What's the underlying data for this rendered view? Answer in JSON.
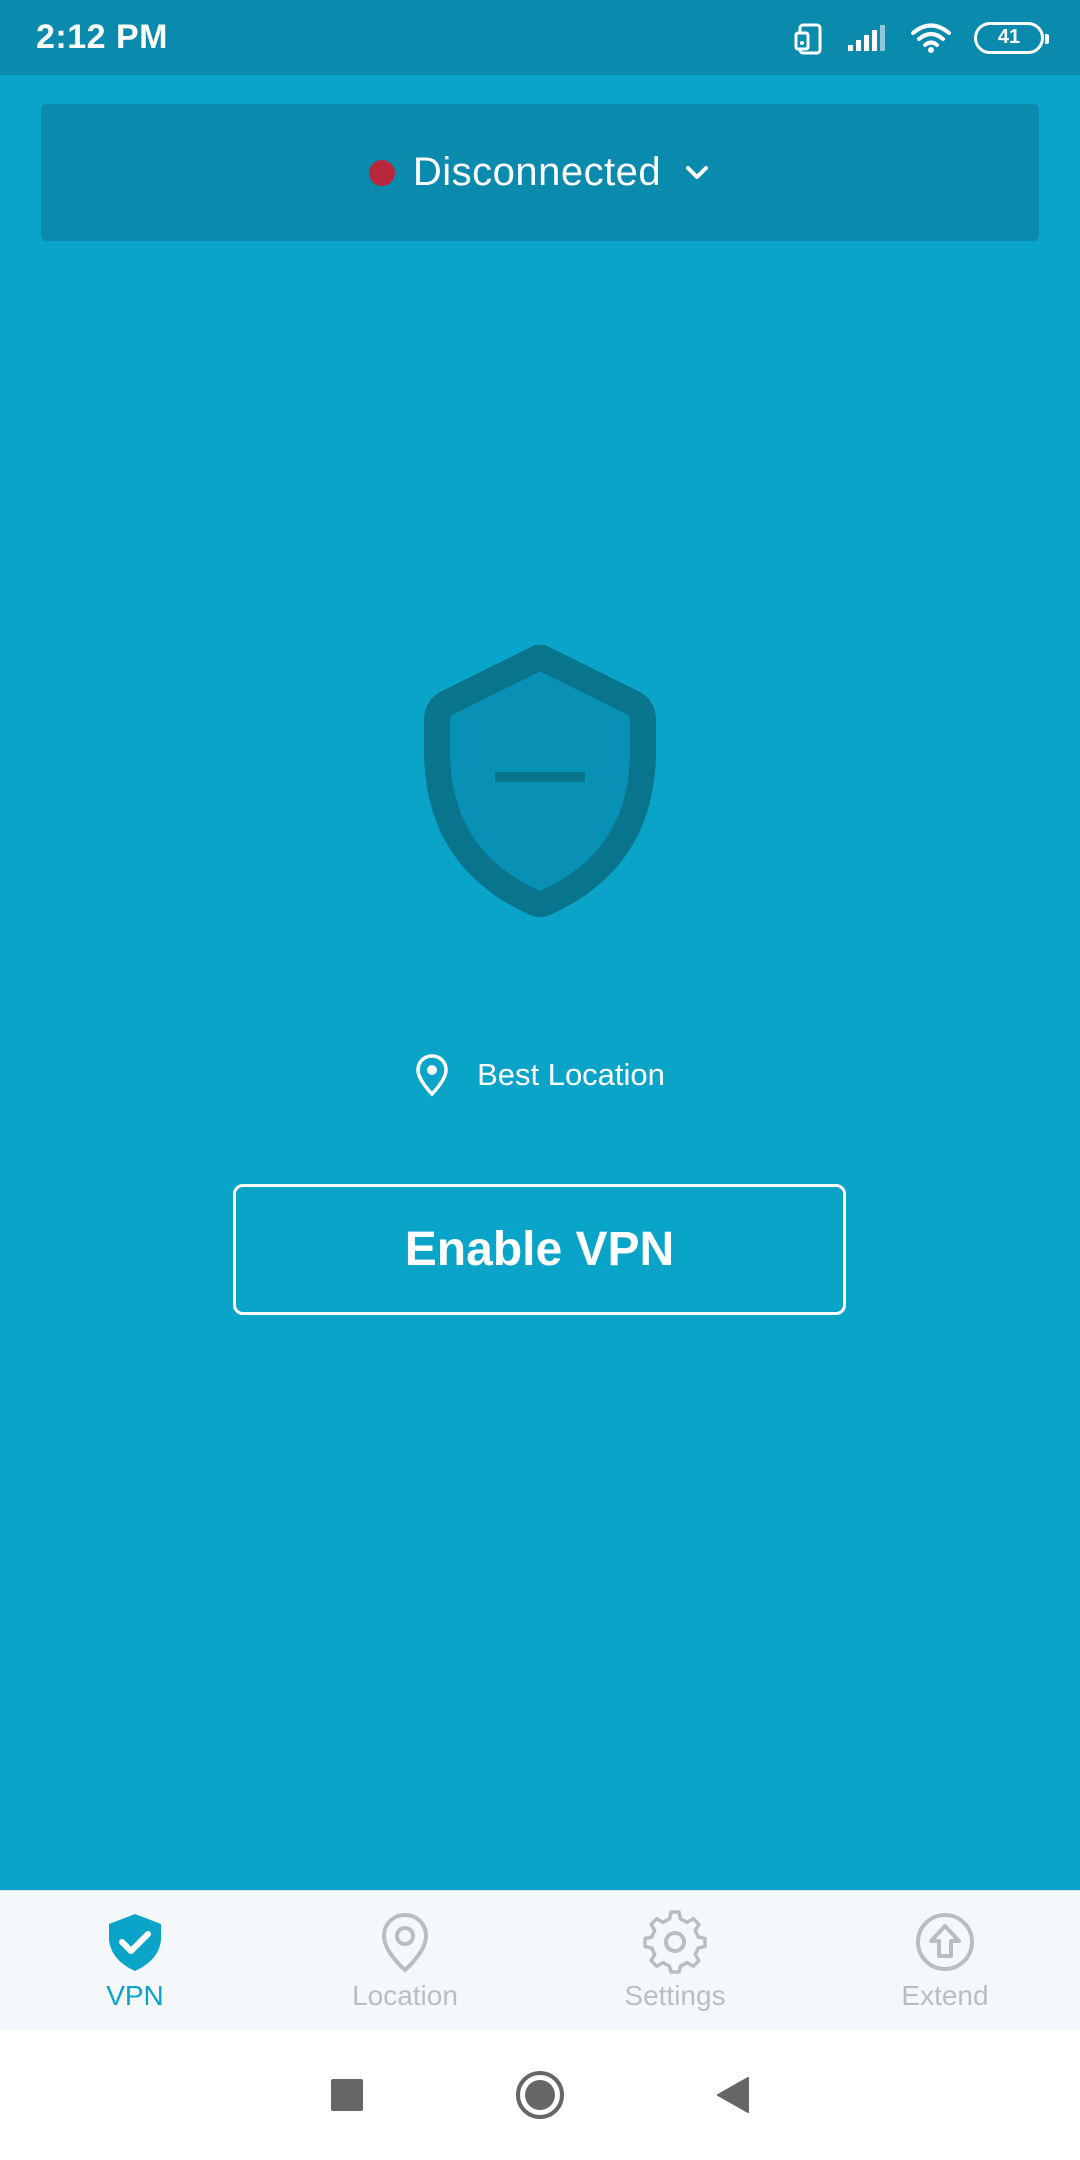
{
  "status_bar": {
    "time": "2:12 PM",
    "battery_level": "41",
    "icons": [
      "rotate-icon",
      "signal-icon",
      "wifi-icon",
      "battery-icon"
    ]
  },
  "connection": {
    "status": "Disconnected",
    "status_color": "#b8273b"
  },
  "location": {
    "label": "Best Location"
  },
  "actions": {
    "enable_label": "Enable VPN"
  },
  "nav": {
    "items": [
      {
        "label": "VPN",
        "icon": "shield-check-icon",
        "active": true
      },
      {
        "label": "Location",
        "icon": "location-pin-icon",
        "active": false
      },
      {
        "label": "Settings",
        "icon": "gear-icon",
        "active": false
      },
      {
        "label": "Extend",
        "icon": "upload-circle-icon",
        "active": false
      }
    ]
  },
  "colors": {
    "primary": "#0aa4c8",
    "primary_dark": "#0a8aad",
    "shield_outline": "#08758d",
    "shield_fill": "#0891b5",
    "nav_inactive": "#b7bec3"
  }
}
